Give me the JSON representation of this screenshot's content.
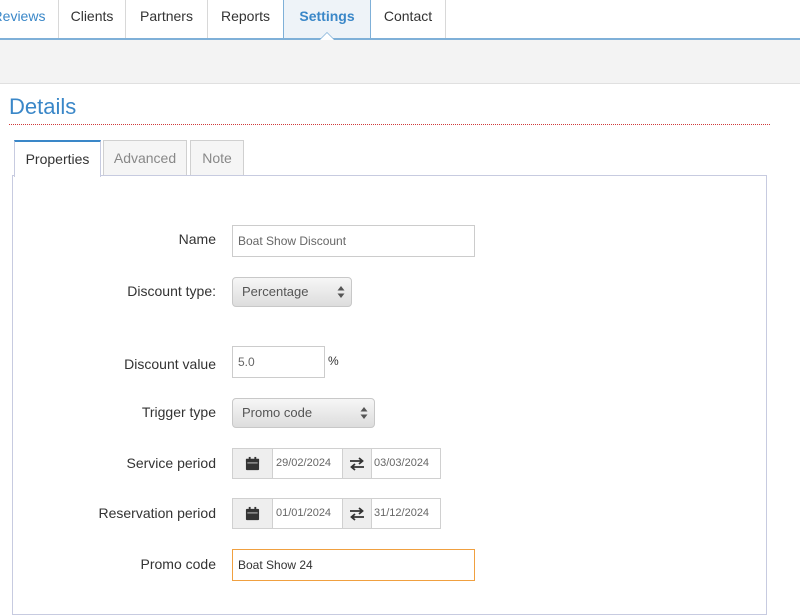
{
  "topnav": {
    "tabs": [
      {
        "label": "Reviews"
      },
      {
        "label": "Clients"
      },
      {
        "label": "Partners"
      },
      {
        "label": "Reports"
      },
      {
        "label": "Settings"
      },
      {
        "label": "Contact"
      }
    ],
    "active_tab": "Settings"
  },
  "section": {
    "title": "Details"
  },
  "inner_tabs": [
    {
      "label": "Properties"
    },
    {
      "label": "Advanced"
    },
    {
      "label": "Note"
    }
  ],
  "form": {
    "name": {
      "label": "Name",
      "value": "Boat Show Discount"
    },
    "discount_type": {
      "label": "Discount type:",
      "value": "Percentage"
    },
    "discount_value": {
      "label": "Discount value",
      "value": "5.0",
      "unit": "%"
    },
    "trigger_type": {
      "label": "Trigger type",
      "value": "Promo code"
    },
    "service_period": {
      "label": "Service period",
      "from": "29/02/2024",
      "to": "03/03/2024"
    },
    "reservation_period": {
      "label": "Reservation period",
      "from": "01/01/2024",
      "to": "31/12/2024"
    },
    "promo_code": {
      "label": "Promo code",
      "value": "Boat Show 24"
    }
  },
  "icons": {
    "calendar": "calendar-icon",
    "swap": "swap-arrows-icon",
    "select_arrows": "updown-arrows-icon"
  },
  "colors": {
    "accent": "#3a87c8",
    "focus_border": "#f0a040"
  }
}
